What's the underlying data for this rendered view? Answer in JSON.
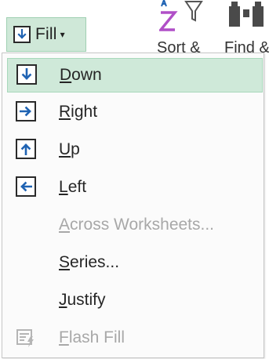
{
  "ribbon": {
    "fill_button": {
      "label": "Fill",
      "caret": "▾"
    },
    "sort_filter": {
      "label_cut": "Sort &"
    },
    "find_select": {
      "label_cut": "Find &"
    }
  },
  "menu": {
    "items": [
      {
        "label_first": "D",
        "label_rest": "own",
        "enabled": true,
        "hover": true,
        "icon": "fill-down-icon"
      },
      {
        "label_first": "R",
        "label_rest": "ight",
        "enabled": true,
        "hover": false,
        "icon": "fill-right-icon"
      },
      {
        "label_first": "U",
        "label_rest": "p",
        "enabled": true,
        "hover": false,
        "icon": "fill-up-icon"
      },
      {
        "label_first": "L",
        "label_rest": "eft",
        "enabled": true,
        "hover": false,
        "icon": "fill-left-icon"
      },
      {
        "label_first": "A",
        "label_rest": "cross Worksheets...",
        "enabled": false,
        "hover": false,
        "icon": ""
      },
      {
        "label_first": "S",
        "label_rest": "eries...",
        "enabled": true,
        "hover": false,
        "icon": ""
      },
      {
        "label_first": "J",
        "label_rest": "ustify",
        "enabled": true,
        "hover": false,
        "icon": ""
      },
      {
        "label_first": "F",
        "label_rest": "lash Fill",
        "enabled": false,
        "hover": false,
        "icon": "flash-fill-icon"
      }
    ]
  },
  "colors": {
    "accent": "#1f63b3",
    "hover_bg": "#cfe9d9",
    "disabled_text": "#a8a8a8",
    "sort_z": "#b04fc7"
  }
}
